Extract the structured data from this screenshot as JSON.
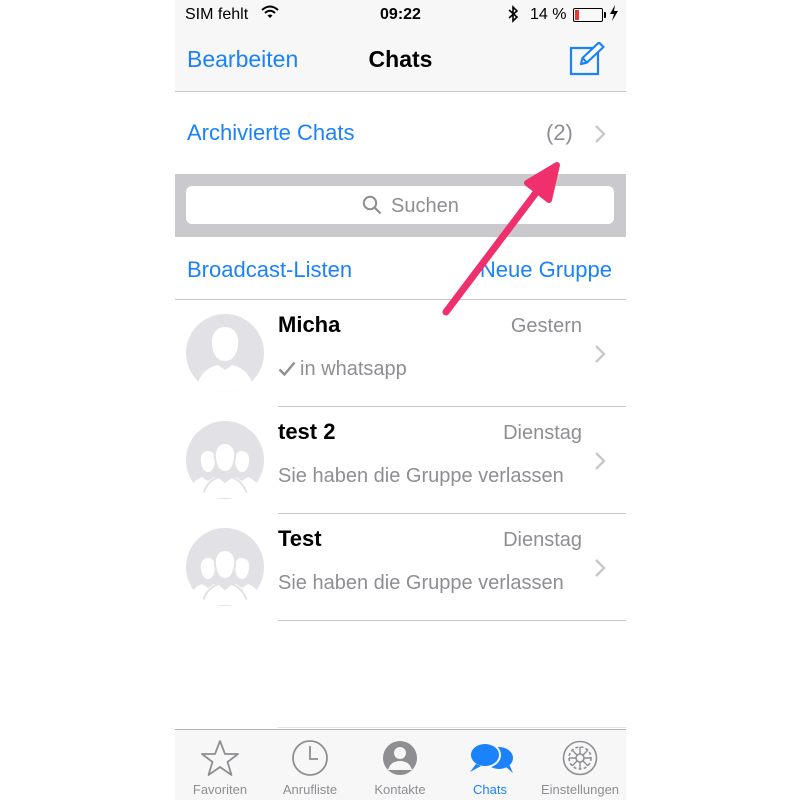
{
  "status_bar": {
    "carrier": "SIM fehlt",
    "time": "09:22",
    "battery_percent_text": "14 %",
    "battery_level": 0.14
  },
  "nav": {
    "edit_label": "Bearbeiten",
    "title": "Chats",
    "compose_icon": "compose-icon"
  },
  "archived": {
    "label": "Archivierte Chats",
    "count": "(2)"
  },
  "search": {
    "placeholder": "Suchen"
  },
  "lists": {
    "broadcast_label": "Broadcast-Listen",
    "new_group_label": "Neue Gruppe"
  },
  "chats": [
    {
      "name": "Micha",
      "time": "Gestern",
      "preview": "in whatsapp",
      "avatar": "person-avatar",
      "delivered": true
    },
    {
      "name": "test 2",
      "time": "Dienstag",
      "preview": "Sie haben die Gruppe verlassen",
      "avatar": "group-avatar",
      "delivered": false
    },
    {
      "name": "Test",
      "time": "Dienstag",
      "preview": "Sie haben die Gruppe verlassen",
      "avatar": "group-avatar",
      "delivered": false
    }
  ],
  "tabs": [
    {
      "label": "Favoriten",
      "icon": "star-icon",
      "active": false
    },
    {
      "label": "Anrufliste",
      "icon": "clock-icon",
      "active": false
    },
    {
      "label": "Kontakte",
      "icon": "contact-icon",
      "active": false
    },
    {
      "label": "Chats",
      "icon": "chat-bubbles-icon",
      "active": true
    },
    {
      "label": "Einstellungen",
      "icon": "gear-icon",
      "active": false
    }
  ],
  "colors": {
    "accent": "#1a82fb",
    "annotation_arrow": "#f0306d",
    "battery_low": "#e53935"
  }
}
